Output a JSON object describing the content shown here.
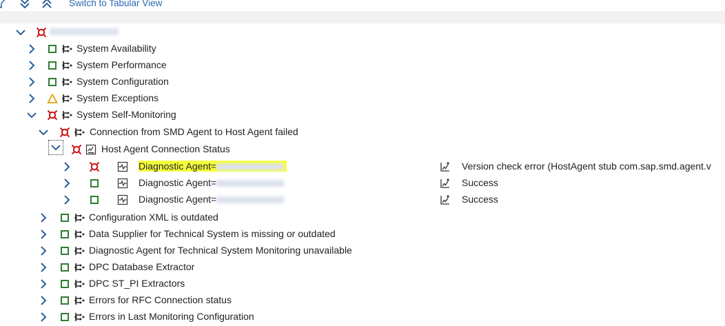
{
  "toolbar": {
    "filter_icon": "filter-icon",
    "expand_all_icon": "double-chevron-down-icon",
    "collapse_all_icon": "double-chevron-up-icon",
    "switch_view_label": "Switch to Tabular View"
  },
  "colors": {
    "alert_red": "#cc1111",
    "ok_green": "#2e7d32",
    "warning_orange": "#e8a000",
    "chevron_blue": "#2a5f99",
    "link_blue": "#2a6ab4",
    "highlight": "#f6ff3c"
  },
  "tree": {
    "root": {
      "status": "red",
      "expanded": true
    },
    "categories": [
      {
        "label": "System Availability",
        "status": "green",
        "expanded": false
      },
      {
        "label": "System Performance",
        "status": "green",
        "expanded": false
      },
      {
        "label": "System Configuration",
        "status": "green",
        "expanded": false
      },
      {
        "label": "System Exceptions",
        "status": "orange",
        "expanded": false
      },
      {
        "label": "System Self-Monitoring",
        "status": "red",
        "expanded": true
      }
    ],
    "self_monitoring": {
      "alert": {
        "label": "Connection from SMD Agent to Host Agent failed",
        "status": "red",
        "expanded": true
      },
      "metric": {
        "label": "Host Agent Connection Status",
        "status": "red",
        "expanded": true
      },
      "instances": [
        {
          "label": "Diagnostic Agent=",
          "status": "red",
          "result": "Version check error (HostAgent stub com.sap.smd.agent.v"
        },
        {
          "label": "Diagnostic Agent=",
          "status": "green",
          "result": "Success"
        },
        {
          "label": "Diagnostic Agent=",
          "status": "green",
          "result": "Success"
        }
      ],
      "siblings": [
        {
          "label": "Configuration XML is outdated",
          "status": "green"
        },
        {
          "label": "Data Supplier for Technical System is missing or outdated",
          "status": "green"
        },
        {
          "label": "Diagnostic Agent for Technical System Monitoring unavailable",
          "status": "green"
        },
        {
          "label": "DPC Database Extractor",
          "status": "green"
        },
        {
          "label": "DPC ST_PI Extractors",
          "status": "green"
        },
        {
          "label": "Errors for RFC Connection status",
          "status": "green"
        },
        {
          "label": "Errors in Last Monitoring Configuration",
          "status": "green"
        }
      ]
    }
  }
}
